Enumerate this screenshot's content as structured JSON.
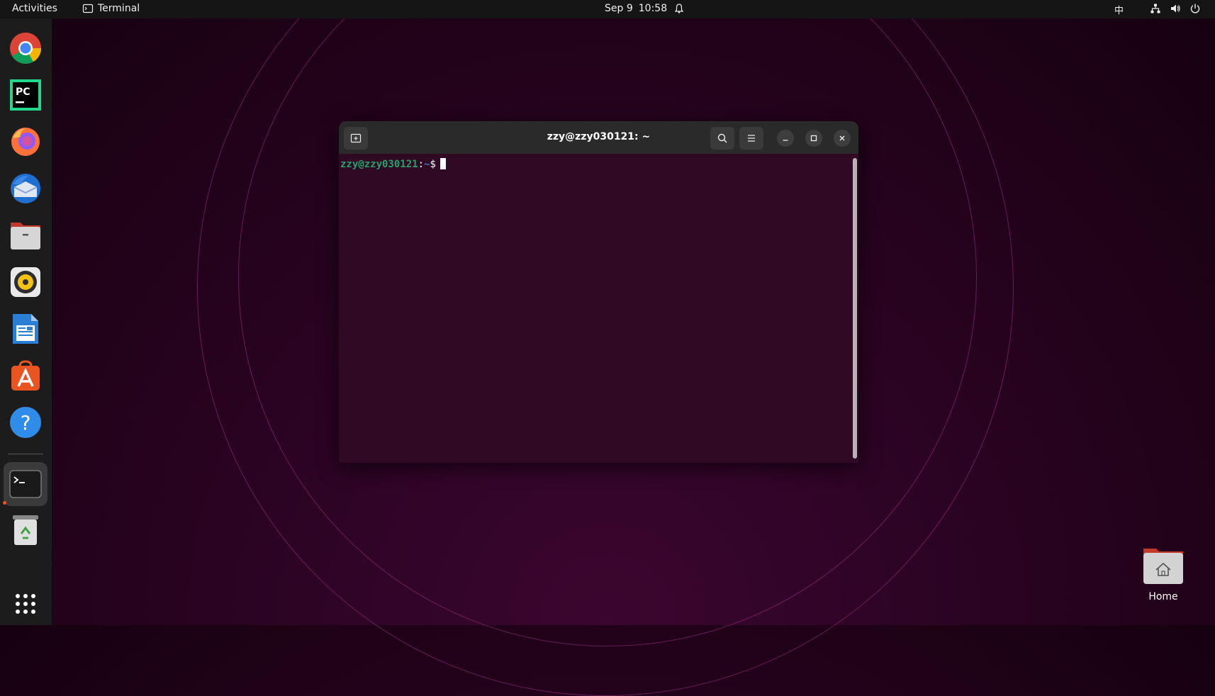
{
  "topbar": {
    "activities": "Activities",
    "app_name": "Terminal",
    "date": "Sep 9",
    "time": "10:58",
    "input_method": "中"
  },
  "dock": {
    "apps": [
      {
        "name": "Google Chrome",
        "icon": "chrome-icon"
      },
      {
        "name": "PyCharm",
        "icon": "pycharm-icon"
      },
      {
        "name": "Firefox",
        "icon": "firefox-icon"
      },
      {
        "name": "Thunderbird",
        "icon": "thunderbird-icon"
      },
      {
        "name": "Files",
        "icon": "files-icon"
      },
      {
        "name": "Rhythmbox",
        "icon": "rhythmbox-icon"
      },
      {
        "name": "LibreOffice Writer",
        "icon": "writer-icon"
      },
      {
        "name": "Ubuntu Software",
        "icon": "software-icon"
      },
      {
        "name": "Help",
        "icon": "help-icon"
      },
      {
        "name": "Terminal",
        "icon": "terminal-icon",
        "active": true
      },
      {
        "name": "Trash",
        "icon": "trash-icon"
      }
    ],
    "show_apps_icon": "grid-icon"
  },
  "terminal": {
    "title": "zzy@zzy030121: ~",
    "prompt_user": "zzy@zzy030121",
    "prompt_colon": ":",
    "prompt_path": "~",
    "prompt_symbol": "$"
  },
  "desktop": {
    "home_label": "Home"
  },
  "colors": {
    "accent": "#e95420",
    "terminal_bg": "#300a24",
    "prompt_user": "#26a269",
    "prompt_path": "#3d72c4"
  }
}
